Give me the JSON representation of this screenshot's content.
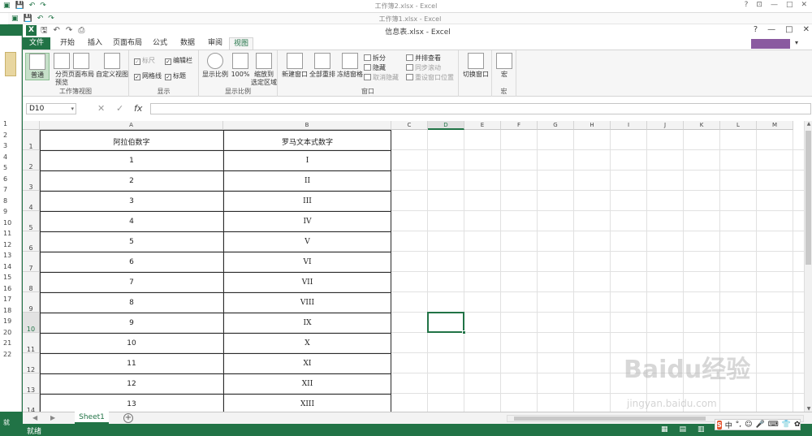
{
  "background_windows": {
    "win1_title": "工作簿2.xlsx - Excel",
    "win2_title": "工作簿1.xlsx - Excel",
    "left_row_numbers": [
      "1",
      "2",
      "3",
      "4",
      "5",
      "6",
      "7",
      "8",
      "9",
      "10",
      "11",
      "12",
      "13",
      "14",
      "15",
      "16",
      "17",
      "18",
      "19",
      "20",
      "21",
      "22"
    ],
    "left_status": "就"
  },
  "window": {
    "title": "信息表.xlsx - Excel",
    "app_icon": "X",
    "qat": [
      "save-icon",
      "undo-icon",
      "redo-icon",
      "print-preview-icon"
    ],
    "controls": [
      "?",
      "—",
      "□",
      "✕"
    ]
  },
  "ribbon_tabs": [
    "文件",
    "开始",
    "插入",
    "页面布局",
    "公式",
    "数据",
    "审阅",
    "视图"
  ],
  "active_tab": "视图",
  "ribbon": {
    "group_workbook_views": {
      "label": "工作簿视图",
      "normal": "普通",
      "page_break": "分页\n预览",
      "page_layout": "页面布局",
      "custom_views": "自定义视图"
    },
    "group_show": {
      "label": "显示",
      "ruler": "标尺",
      "formula_bar": "编辑栏",
      "gridlines": "网格线",
      "headings": "标题"
    },
    "group_zoom": {
      "label": "显示比例",
      "zoom": "显示比例",
      "zoom100": "100%",
      "zoom_selection": "缩放到\n选定区域"
    },
    "group_window": {
      "label": "窗口",
      "new_window": "新建窗口",
      "arrange_all": "全部重排",
      "freeze_panes": "冻结窗格",
      "split": "拆分",
      "hide": "隐藏",
      "unhide": "取消隐藏",
      "side_by_side": "并排查看",
      "sync_scroll": "同步滚动",
      "reset_position": "重设窗口位置",
      "switch_windows": "切换窗口"
    },
    "group_macros": {
      "label": "宏",
      "macros": "宏"
    }
  },
  "formula_bar": {
    "name_box": "D10",
    "cancel": "✕",
    "enter": "✓",
    "fx": "fx",
    "value": ""
  },
  "columns": [
    "A",
    "B",
    "C",
    "D",
    "E",
    "F",
    "G",
    "H",
    "I",
    "J",
    "K",
    "L",
    "M"
  ],
  "selected_column": "D",
  "selected_row": "10",
  "row_numbers": [
    "1",
    "2",
    "3",
    "4",
    "5",
    "6",
    "7",
    "8",
    "9",
    "10",
    "11",
    "12",
    "13",
    "14"
  ],
  "table": {
    "headers": [
      "阿拉伯数字",
      "罗马文本式数字"
    ],
    "rows": [
      [
        "1",
        "I"
      ],
      [
        "2",
        "II"
      ],
      [
        "3",
        "III"
      ],
      [
        "4",
        "IV"
      ],
      [
        "5",
        "V"
      ],
      [
        "6",
        "VI"
      ],
      [
        "7",
        "VII"
      ],
      [
        "8",
        "VIII"
      ],
      [
        "9",
        "IX"
      ],
      [
        "10",
        "X"
      ],
      [
        "11",
        "XI"
      ],
      [
        "12",
        "XII"
      ],
      [
        "13",
        "XIII"
      ]
    ]
  },
  "sheet_tabs": [
    "Sheet1"
  ],
  "status": "就绪",
  "zoom_percent": 100,
  "ime": {
    "logo": "S",
    "items": [
      "中",
      "°,",
      "☺",
      "🎤",
      "⌨",
      "👕",
      "✿"
    ]
  },
  "watermark": "Baidu经验",
  "watermark_url": "jingyan.baidu.com"
}
